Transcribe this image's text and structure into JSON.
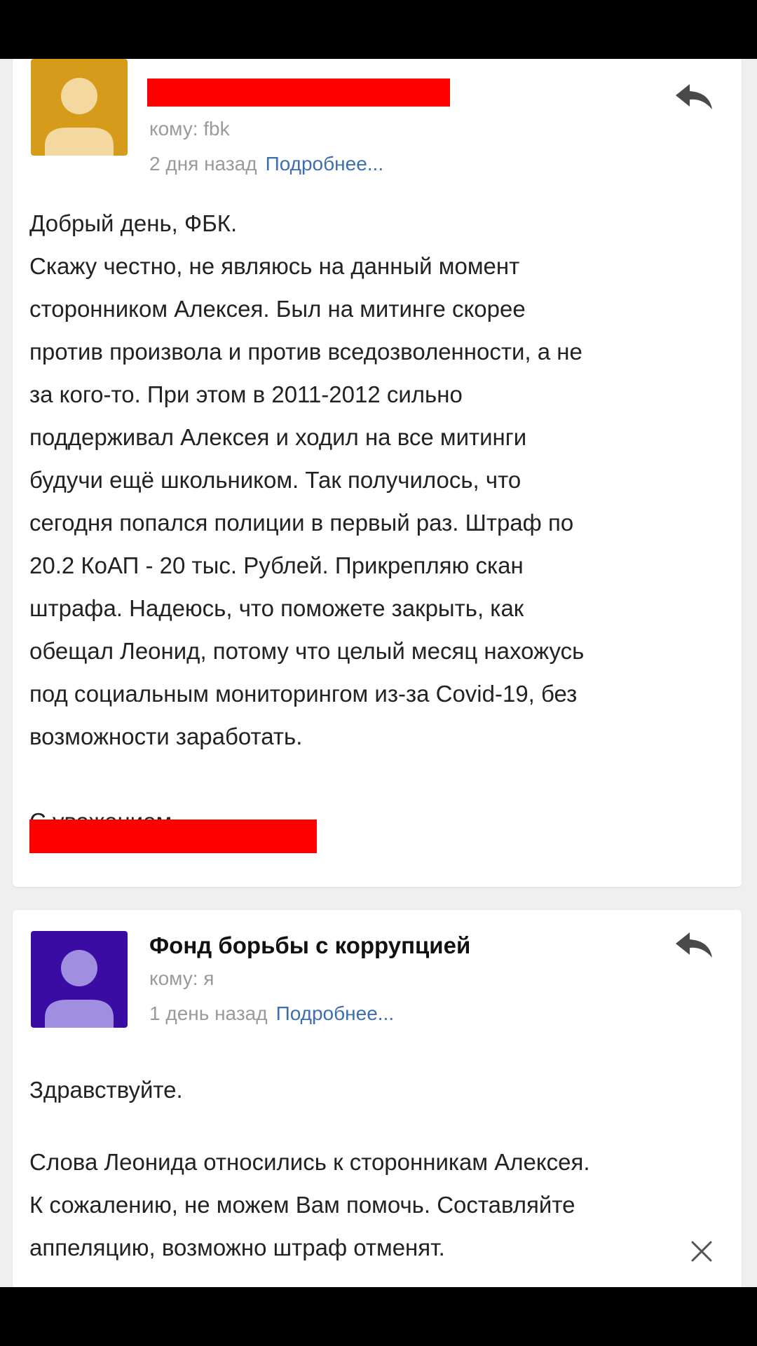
{
  "colors": {
    "background": "#000000",
    "screen": "#efefef",
    "card": "#ffffff",
    "redaction": "#ff0000",
    "link": "#3f6eb0",
    "avatar1_bg": "#d79b1c",
    "avatar1_fg": "#f3d9a0",
    "avatar2_bg": "#3a0ca3",
    "avatar2_fg": "#a08ee0"
  },
  "message1": {
    "avatar_icon": "person-placeholder-icon",
    "to": "кому: fbk",
    "date": "2 дня назад",
    "details_link": "Подробнее...",
    "reply_icon": "reply-icon",
    "body": [
      "Добрый день, ФБК.",
      "Скажу честно, не являюсь на данный момент",
      "сторонником Алексея. Был на митинге скорее",
      "против произвола и против вседозволенности, а не",
      "за кого-то. При этом в 2011-2012 сильно",
      "поддерживал Алексея и ходил на все митинги",
      "будучи ещё школьником. Так получилось, что",
      "сегодня попался полиции в первый раз. Штраф по",
      "20.2 КоАП - 20 тыс. Рублей. Прикрепляю скан",
      "штрафа. Надеюсь, что поможете закрыть, как",
      "обещал Леонид, потому что целый месяц нахожусь",
      "под социальным мониторингом из-за Covid-19, без",
      "возможности заработать."
    ],
    "signoff": "С уважением,"
  },
  "message2": {
    "avatar_icon": "person-placeholder-icon",
    "sender": "Фонд борьбы с коррупцией",
    "to": "кому: я",
    "date": "1 день назад",
    "details_link": "Подробнее...",
    "reply_icon": "reply-icon",
    "greeting": "Здравствуйте.",
    "body": [
      "Слова Леонида относились к сторонникам Алексея.",
      "К сожалению, не можем Вам помочь. Составляйте",
      "аппеляцию, возможно штраф отменят."
    ],
    "close_icon": "close-icon"
  }
}
